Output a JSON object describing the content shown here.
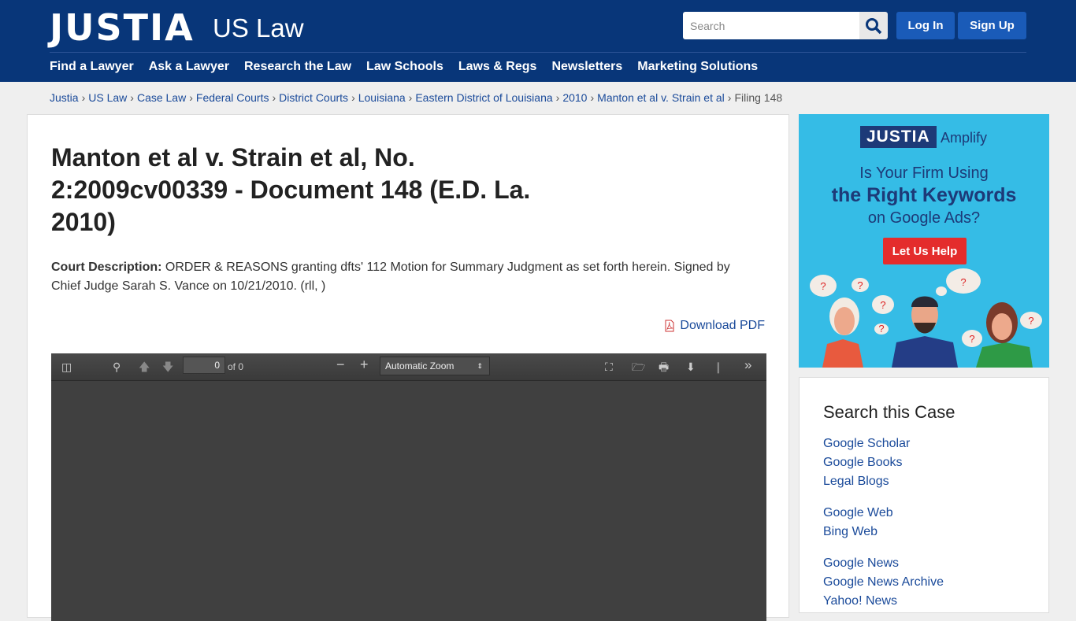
{
  "header": {
    "logo": "JUSTIA",
    "sublogo": "US Law",
    "search_placeholder": "Search",
    "login": "Log In",
    "signup": "Sign Up",
    "nav": [
      "Find a Lawyer",
      "Ask a Lawyer",
      "Research the Law",
      "Law Schools",
      "Laws & Regs",
      "Newsletters",
      "Marketing Solutions"
    ]
  },
  "breadcrumb": [
    "Justia",
    "US Law",
    "Case Law",
    "Federal Courts",
    "District Courts",
    "Louisiana",
    "Eastern District of Louisiana",
    "2010",
    "Manton et al v. Strain et al"
  ],
  "breadcrumb_current": "Filing 148",
  "main": {
    "title": "Manton et al v. Strain et al, No. 2:2009cv00339 - Document 148 (E.D. La. 2010)",
    "desc_label": "Court Description:",
    "desc": " ORDER & REASONS granting dfts' 112 Motion for Summary Judgment as set forth herein. Signed by Chief Judge Sarah S. Vance on 10/21/2010. (rll, )",
    "download": "Download PDF"
  },
  "viewer": {
    "page": "0",
    "of": "of 0",
    "zoom": "Automatic Zoom"
  },
  "ad": {
    "logo": "JUSTIA",
    "product": "Amplify",
    "line1": "Is Your Firm Using",
    "line2": "the Right Keywords",
    "line3": "on Google Ads?",
    "button": "Let Us Help"
  },
  "search_case": {
    "title": "Search this Case",
    "links": [
      "Google Scholar",
      "Google Books",
      "Legal Blogs",
      "Google Web",
      "Bing Web",
      "Google News",
      "Google News Archive",
      "Yahoo! News"
    ]
  }
}
